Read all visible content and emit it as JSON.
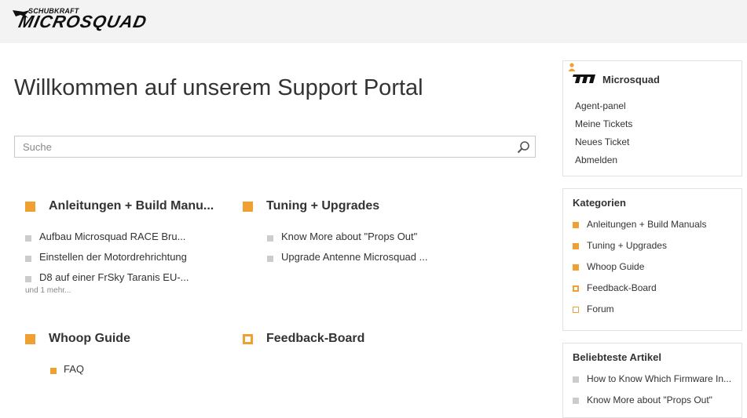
{
  "header": {
    "logo_small": "SCHUBKRAFT",
    "logo_main": "MICROSQUAD"
  },
  "main": {
    "title": "Willkommen auf unserem Support Portal",
    "search_placeholder": "Suche",
    "categories": [
      {
        "title": "Anleitungen + Build Manu...",
        "articles": [
          "Aufbau Microsquad RACE Bru...",
          "Einstellen der Motordrehrichtung",
          "D8 auf einer FrSky Taranis EU-..."
        ],
        "more": "und 1 mehr..."
      },
      {
        "title": "Tuning + Upgrades",
        "articles": [
          "Know More about \"Props Out\"",
          "Upgrade Antenne Microsquad ..."
        ]
      },
      {
        "title": "Whoop Guide",
        "articles": [
          "FAQ"
        ]
      },
      {
        "title": "Feedback-Board",
        "articles": []
      }
    ]
  },
  "user_panel": {
    "name": "Microsquad",
    "links": [
      "Agent-panel",
      "Meine Tickets",
      "Neues Ticket",
      "Abmelden"
    ]
  },
  "categories_panel": {
    "title": "Kategorien",
    "items": [
      "Anleitungen + Build Manuals",
      "Tuning + Upgrades",
      "Whoop Guide",
      "Feedback-Board",
      "Forum"
    ]
  },
  "popular_panel": {
    "title": "Beliebteste Artikel",
    "items": [
      "How to Know Which Firmware In...",
      "Know More about \"Props Out\""
    ]
  },
  "colors": {
    "accent": "#f0a030",
    "topbar": "#f3f3f3",
    "bullet_grey": "#cccccc"
  }
}
